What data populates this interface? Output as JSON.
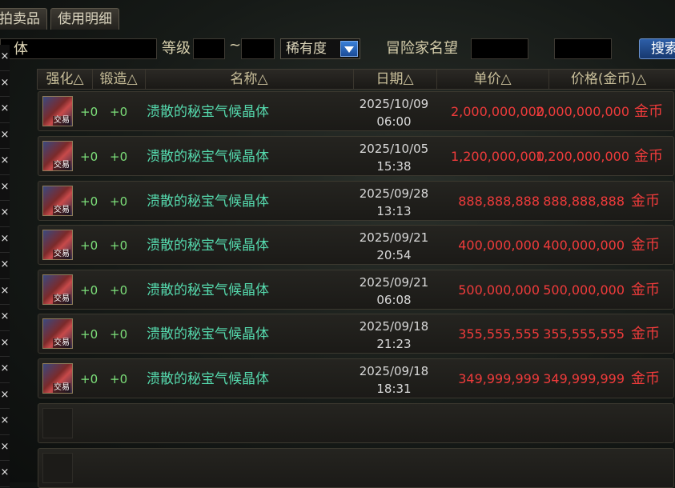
{
  "tabs": [
    "拍卖品",
    "使用明细"
  ],
  "filters": {
    "name_value": "体",
    "level_label": "等级",
    "tilde": "~",
    "rarity_label": "稀有度",
    "adventurer_label": "冒险家名望",
    "search_label": "搜索"
  },
  "headers": {
    "enhance": "强化△",
    "forge": "锻造△",
    "name": "名称△",
    "date": "日期△",
    "unit_price": "单价△",
    "total_price": "价格(金币)△"
  },
  "rows": [
    {
      "enhance": "+0",
      "forge": "+0",
      "name": "溃散的秘宝气候晶体",
      "date": "2025/10/09",
      "time": "06:00",
      "unit_price": "2,000,000,000",
      "total_price": "2,000,000,000",
      "currency": "金币",
      "badge": "交易"
    },
    {
      "enhance": "+0",
      "forge": "+0",
      "name": "溃散的秘宝气候晶体",
      "date": "2025/10/05",
      "time": "15:38",
      "unit_price": "1,200,000,000",
      "total_price": "1,200,000,000",
      "currency": "金币",
      "badge": "交易"
    },
    {
      "enhance": "+0",
      "forge": "+0",
      "name": "溃散的秘宝气候晶体",
      "date": "2025/09/28",
      "time": "13:13",
      "unit_price": "888,888,888",
      "total_price": "888,888,888",
      "currency": "金币",
      "badge": "交易"
    },
    {
      "enhance": "+0",
      "forge": "+0",
      "name": "溃散的秘宝气候晶体",
      "date": "2025/09/21",
      "time": "20:54",
      "unit_price": "400,000,000",
      "total_price": "400,000,000",
      "currency": "金币",
      "badge": "交易"
    },
    {
      "enhance": "+0",
      "forge": "+0",
      "name": "溃散的秘宝气候晶体",
      "date": "2025/09/21",
      "time": "06:08",
      "unit_price": "500,000,000",
      "total_price": "500,000,000",
      "currency": "金币",
      "badge": "交易"
    },
    {
      "enhance": "+0",
      "forge": "+0",
      "name": "溃散的秘宝气候晶体",
      "date": "2025/09/18",
      "time": "21:23",
      "unit_price": "355,555,555",
      "total_price": "355,555,555",
      "currency": "金币",
      "badge": "交易"
    },
    {
      "enhance": "+0",
      "forge": "+0",
      "name": "溃散的秘宝气候晶体",
      "date": "2025/09/18",
      "time": "18:31",
      "unit_price": "349,999,999",
      "total_price": "349,999,999",
      "currency": "金币",
      "badge": "交易"
    }
  ],
  "close_glyph": "×",
  "colors": {
    "price": "#ef3b3b",
    "item_name": "#55d9ad",
    "stat": "#7de07a"
  }
}
